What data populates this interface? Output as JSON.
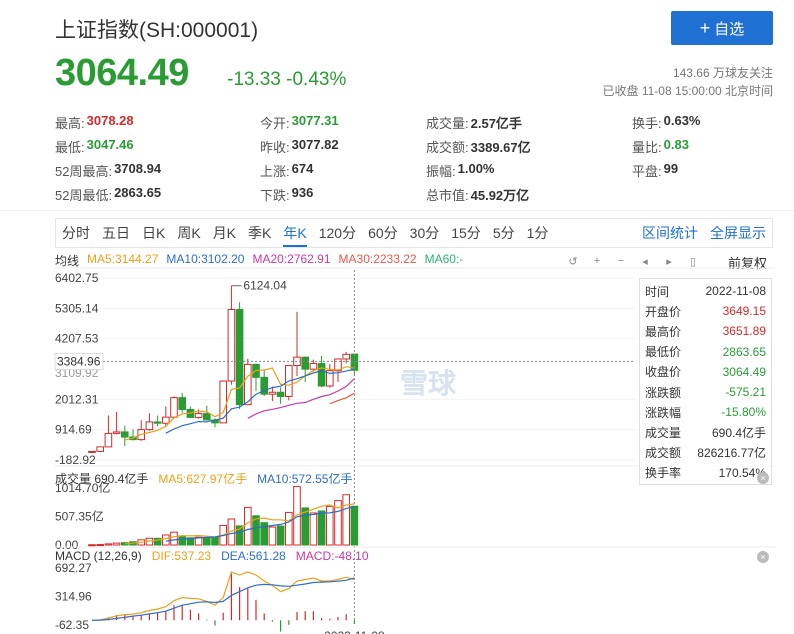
{
  "header": {
    "title": "上证指数(SH:000001)",
    "follow_plus": "+",
    "follow_label": "自选"
  },
  "quote": {
    "price": "3064.49",
    "change": "-13.33 -0.43%",
    "followers": "143.66 万球友关注",
    "status": "已收盘 11-08 15:00:00 北京时间"
  },
  "stats": [
    [
      {
        "label": "最高:",
        "value": "3078.28",
        "color": "red"
      },
      {
        "label": "今开:",
        "value": "3077.31",
        "color": "green"
      },
      {
        "label": "成交量:",
        "value": "2.57亿手",
        "color": ""
      },
      {
        "label": "换手:",
        "value": "0.63%",
        "color": ""
      }
    ],
    [
      {
        "label": "最低:",
        "value": "3047.46",
        "color": "green"
      },
      {
        "label": "昨收:",
        "value": "3077.82",
        "color": ""
      },
      {
        "label": "成交额:",
        "value": "3389.67亿",
        "color": ""
      },
      {
        "label": "量比:",
        "value": "0.83",
        "color": "green"
      }
    ],
    [
      {
        "label": "52周最高:",
        "value": "3708.94",
        "color": ""
      },
      {
        "label": "上涨:",
        "value": "674",
        "color": ""
      },
      {
        "label": "振幅:",
        "value": "1.00%",
        "color": ""
      },
      {
        "label": "平盘:",
        "value": "99",
        "color": ""
      }
    ],
    [
      {
        "label": "52周最低:",
        "value": "2863.65",
        "color": ""
      },
      {
        "label": "下跌:",
        "value": "936",
        "color": ""
      },
      {
        "label": "总市值:",
        "value": "45.92万亿",
        "color": ""
      },
      {
        "label": "",
        "value": "",
        "color": ""
      }
    ]
  ],
  "tabs": [
    "分时",
    "五日",
    "日K",
    "周K",
    "月K",
    "季K",
    "年K",
    "120分",
    "60分",
    "30分",
    "15分",
    "5分",
    "1分"
  ],
  "active_tab": "年K",
  "tab_right": [
    "区间统计",
    "全屏显示"
  ],
  "ma_legend": {
    "label": "均线",
    "ma5": "MA5:3144.27",
    "ma10": "MA10:3102.20",
    "ma20": "MA20:2762.91",
    "ma30": "MA30:2233.22",
    "ma60": "MA60:-"
  },
  "adjust_label": "前复权",
  "y_axis": [
    "6402.75",
    "5305.14",
    "4207.53",
    "3384.96",
    "2012.31",
    "914.69",
    "-182.92"
  ],
  "y_axis_extra": "3109.92",
  "crosshair_value": "3384.96",
  "peak_label": "6124.04",
  "info_box": [
    {
      "label": "时间",
      "value": "2022-11-08",
      "color": ""
    },
    {
      "label": "开盘价",
      "value": "3649.15",
      "color": "red"
    },
    {
      "label": "最高价",
      "value": "3651.89",
      "color": "red"
    },
    {
      "label": "最低价",
      "value": "2863.65",
      "color": "green"
    },
    {
      "label": "收盘价",
      "value": "3064.49",
      "color": "green"
    },
    {
      "label": "涨跌额",
      "value": "-575.21",
      "color": "green"
    },
    {
      "label": "涨跌幅",
      "value": "-15.80%",
      "color": "green"
    },
    {
      "label": "成交量",
      "value": "690.4亿手",
      "color": ""
    },
    {
      "label": "成交额",
      "value": "826216.77亿",
      "color": ""
    },
    {
      "label": "换手率",
      "value": "170.54%",
      "color": ""
    }
  ],
  "vol_legend": {
    "label": "成交量 690.4亿手",
    "ma5": "MA5:627.97亿手",
    "ma10": "MA10:572.55亿手"
  },
  "vol_axis": [
    "1014.70亿",
    "507.35亿",
    "0.00"
  ],
  "macd_legend": {
    "label": "MACD (12,26,9)",
    "dif": "DIF:537.23",
    "dea": "DEA:561.28",
    "macd": "MACD:-48.10"
  },
  "macd_axis": [
    "692.27",
    "314.96",
    "-62.35"
  ],
  "date_label": "2022-11-08",
  "watermark": "雪球",
  "colors": {
    "up": "#d12c2c",
    "down": "#2a9c34",
    "accent": "#1e71d3",
    "ma5": "#e8a21a",
    "ma10": "#2d6ec9",
    "ma20": "#c93aa5",
    "ma30": "#e35b4c",
    "ma60": "#2ab470"
  },
  "chart_data": {
    "type": "candlestick",
    "y_range": [
      -182.92,
      6402.75
    ],
    "candles_note": "annual K-line, 1990-2022 approx",
    "candles": [
      {
        "o": 100,
        "c": 128,
        "h": 130,
        "l": 96
      },
      {
        "o": 128,
        "c": 292,
        "h": 292,
        "l": 105
      },
      {
        "o": 292,
        "c": 780,
        "h": 1429,
        "l": 292
      },
      {
        "o": 780,
        "c": 833,
        "h": 1558,
        "l": 750
      },
      {
        "o": 833,
        "c": 648,
        "h": 1052,
        "l": 325
      },
      {
        "o": 648,
        "c": 555,
        "h": 926,
        "l": 524
      },
      {
        "o": 555,
        "c": 917,
        "h": 1258,
        "l": 512
      },
      {
        "o": 917,
        "c": 1194,
        "h": 1510,
        "l": 870
      },
      {
        "o": 1194,
        "c": 1147,
        "h": 1422,
        "l": 1043
      },
      {
        "o": 1147,
        "c": 1367,
        "h": 1756,
        "l": 1047
      },
      {
        "o": 1367,
        "c": 2073,
        "h": 2125,
        "l": 1361
      },
      {
        "o": 2073,
        "c": 1646,
        "h": 2245,
        "l": 1514
      },
      {
        "o": 1646,
        "c": 1357,
        "h": 1748,
        "l": 1339
      },
      {
        "o": 1357,
        "c": 1497,
        "h": 1649,
        "l": 1307
      },
      {
        "o": 1497,
        "c": 1266,
        "h": 1783,
        "l": 1259
      },
      {
        "o": 1266,
        "c": 1161,
        "h": 1328,
        "l": 998
      },
      {
        "o": 1161,
        "c": 2675,
        "h": 2698,
        "l": 1163
      },
      {
        "o": 2675,
        "c": 5262,
        "h": 6124,
        "l": 2541
      },
      {
        "o": 5262,
        "c": 1820,
        "h": 5522,
        "l": 1664
      },
      {
        "o": 1820,
        "c": 3277,
        "h": 3478,
        "l": 1844
      },
      {
        "o": 3277,
        "c": 2808,
        "h": 3306,
        "l": 2319
      },
      {
        "o": 2808,
        "c": 2199,
        "h": 3067,
        "l": 2134
      },
      {
        "o": 2199,
        "c": 2269,
        "h": 2478,
        "l": 1949
      },
      {
        "o": 2269,
        "c": 2116,
        "h": 2444,
        "l": 1849
      },
      {
        "o": 2116,
        "c": 3235,
        "h": 3239,
        "l": 1974
      },
      {
        "o": 3235,
        "c": 3539,
        "h": 5178,
        "l": 2850
      },
      {
        "o": 3539,
        "c": 3104,
        "h": 3539,
        "l": 2638
      },
      {
        "o": 3104,
        "c": 3307,
        "h": 3450,
        "l": 3016
      },
      {
        "o": 3307,
        "c": 2494,
        "h": 3587,
        "l": 2449
      },
      {
        "o": 2494,
        "c": 3050,
        "h": 3288,
        "l": 2440
      },
      {
        "o": 3050,
        "c": 3473,
        "h": 3474,
        "l": 2646
      },
      {
        "o": 3473,
        "c": 3640,
        "h": 3731,
        "l": 3312
      },
      {
        "o": 3649,
        "c": 3064,
        "h": 3652,
        "l": 2864
      }
    ],
    "ma5": [
      null,
      null,
      null,
      null,
      536,
      610,
      747,
      812,
      892,
      1036,
      1340,
      1485,
      1518,
      1588,
      1566,
      1385,
      1531,
      2371,
      2423,
      2847,
      3057,
      3073,
      3142,
      2551,
      2525,
      2637,
      2860,
      3060,
      3148,
      3099,
      3074,
      3193,
      3144
    ],
    "ma10": [
      null,
      null,
      null,
      null,
      null,
      null,
      null,
      null,
      null,
      786,
      938,
      1060,
      1132,
      1205,
      1201,
      1262,
      1331,
      1669,
      1732,
      1924,
      2198,
      2329,
      2437,
      2487,
      2674,
      2760,
      2860,
      2965,
      3054,
      2949,
      2977,
      3034,
      3102
    ],
    "ma20": [
      null,
      null,
      null,
      null,
      null,
      null,
      null,
      null,
      null,
      null,
      null,
      null,
      null,
      null,
      null,
      null,
      null,
      null,
      null,
      1325,
      1486,
      1599,
      1650,
      1712,
      1796,
      1867,
      1896,
      2014,
      2115,
      2180,
      2315,
      2481,
      2763
    ],
    "ma30": [
      null,
      null,
      null,
      null,
      null,
      null,
      null,
      null,
      null,
      null,
      null,
      null,
      null,
      null,
      null,
      null,
      null,
      null,
      null,
      null,
      null,
      null,
      null,
      null,
      null,
      null,
      null,
      null,
      null,
      1854,
      1965,
      2068,
      2233
    ],
    "volume": [
      5,
      8,
      20,
      34,
      42,
      58,
      92,
      120,
      120,
      178,
      228,
      162,
      128,
      138,
      134,
      142,
      348,
      463,
      340,
      670,
      520,
      397,
      320,
      338,
      580,
      1040,
      660,
      570,
      605,
      688,
      790,
      895,
      690
    ],
    "macd_dif": [
      0,
      5,
      30,
      60,
      75,
      82,
      100,
      130,
      150,
      180,
      260,
      300,
      290,
      285,
      250,
      200,
      300,
      640,
      600,
      640,
      600,
      520,
      460,
      380,
      420,
      520,
      540,
      560,
      520,
      520,
      540,
      570,
      537
    ],
    "macd_dea": [
      0,
      2,
      10,
      25,
      40,
      55,
      68,
      85,
      100,
      120,
      160,
      200,
      220,
      240,
      245,
      235,
      250,
      330,
      380,
      430,
      465,
      475,
      470,
      455,
      450,
      465,
      480,
      500,
      505,
      510,
      518,
      530,
      561
    ],
    "macd_hist": [
      0,
      6,
      40,
      70,
      70,
      54,
      64,
      90,
      100,
      120,
      200,
      200,
      140,
      90,
      10,
      -70,
      100,
      620,
      440,
      420,
      270,
      90,
      -20,
      -150,
      -60,
      110,
      120,
      120,
      30,
      20,
      44,
      80,
      -48
    ]
  }
}
